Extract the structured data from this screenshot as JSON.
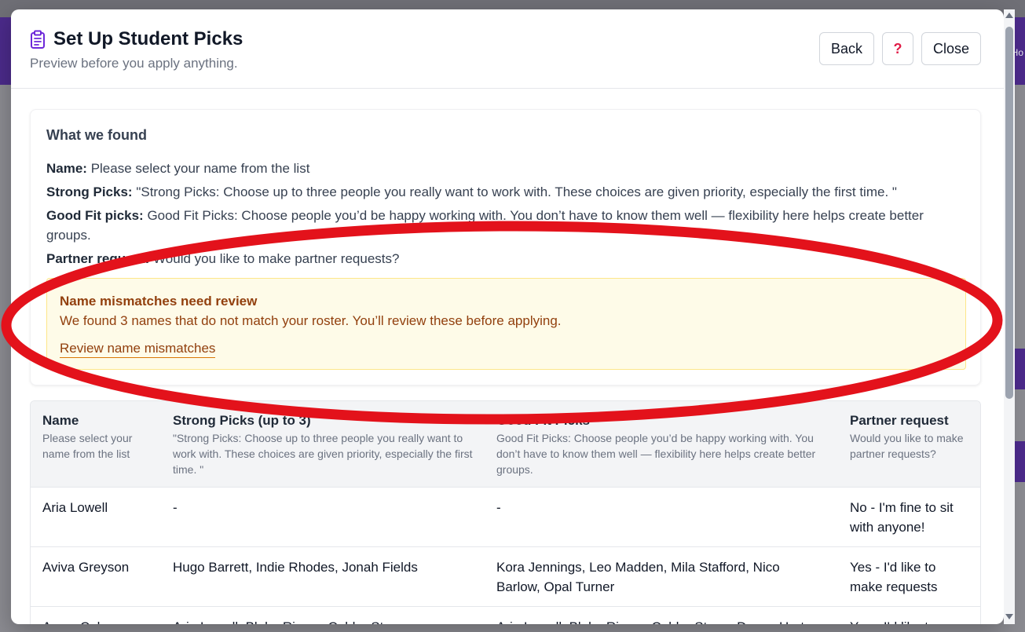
{
  "dialog": {
    "title": "Set Up Student Picks",
    "subtitle": "Preview before you apply anything.",
    "back_label": "Back",
    "help_label": "?",
    "close_label": "Close"
  },
  "found": {
    "heading": "What we found",
    "lines": [
      {
        "label": "Name:",
        "value": " Please select your name from the list"
      },
      {
        "label": "Strong Picks:",
        "value": " \"Strong Picks: Choose up to three people you really want to work with. These choices are given priority, especially the first time. \""
      },
      {
        "label": "Good Fit picks:",
        "value": " Good Fit Picks: Choose people you’d be happy working with. You don’t have to know them well — flexibility here helps create better groups."
      },
      {
        "label": "Partner request:",
        "value": " Would you like to make partner requests?"
      }
    ]
  },
  "warning": {
    "title": "Name mismatches need review",
    "text": "We found 3 names that do not match your roster. You’ll review these before applying.",
    "link": "Review name mismatches",
    "accent_color": "#92400e",
    "background_color": "#fefbe8"
  },
  "table": {
    "columns": [
      {
        "title": "Name",
        "sub": "Please select your name from the list"
      },
      {
        "title": "Strong Picks (up to 3)",
        "sub": "\"Strong Picks: Choose up to three people you really want to work with. These choices are given priority, especially the first time. \""
      },
      {
        "title": "Good Fit Picks",
        "sub": "Good Fit Picks: Choose people you’d be happy working with. You don’t have to know them well — flexibility here helps create better groups."
      },
      {
        "title": "Partner request",
        "sub": "Would you like to make partner requests?"
      }
    ],
    "rows": [
      {
        "name": "Aria Lowell",
        "strong": "-",
        "goodfit": "-",
        "partner": "No - I'm fine to sit with anyone!"
      },
      {
        "name": "Aviva Greyson",
        "strong": "Hugo Barrett, Indie Rhodes, Jonah Fields",
        "goodfit": "Kora Jennings, Leo Madden, Mila Stafford, Nico Barlow, Opal Turner",
        "partner": "Yes - I'd like to make requests"
      },
      {
        "name": "Avery Cole",
        "strong": "Aria Lowell, Blake Rivers, Calder Stone",
        "goodfit": "Aria Lowell, Blake Rivers, Calder Stone, Devon Hart,",
        "partner": "Yes - I'd like to"
      }
    ]
  },
  "background": {
    "right_text": "Ho"
  },
  "icons": {
    "title_icon": "clipboard-icon",
    "annotation": "red-ellipse-annotation"
  },
  "colors": {
    "title_icon": "#6d28d9",
    "help": "#e11d48",
    "annotation": "#e3121b"
  }
}
